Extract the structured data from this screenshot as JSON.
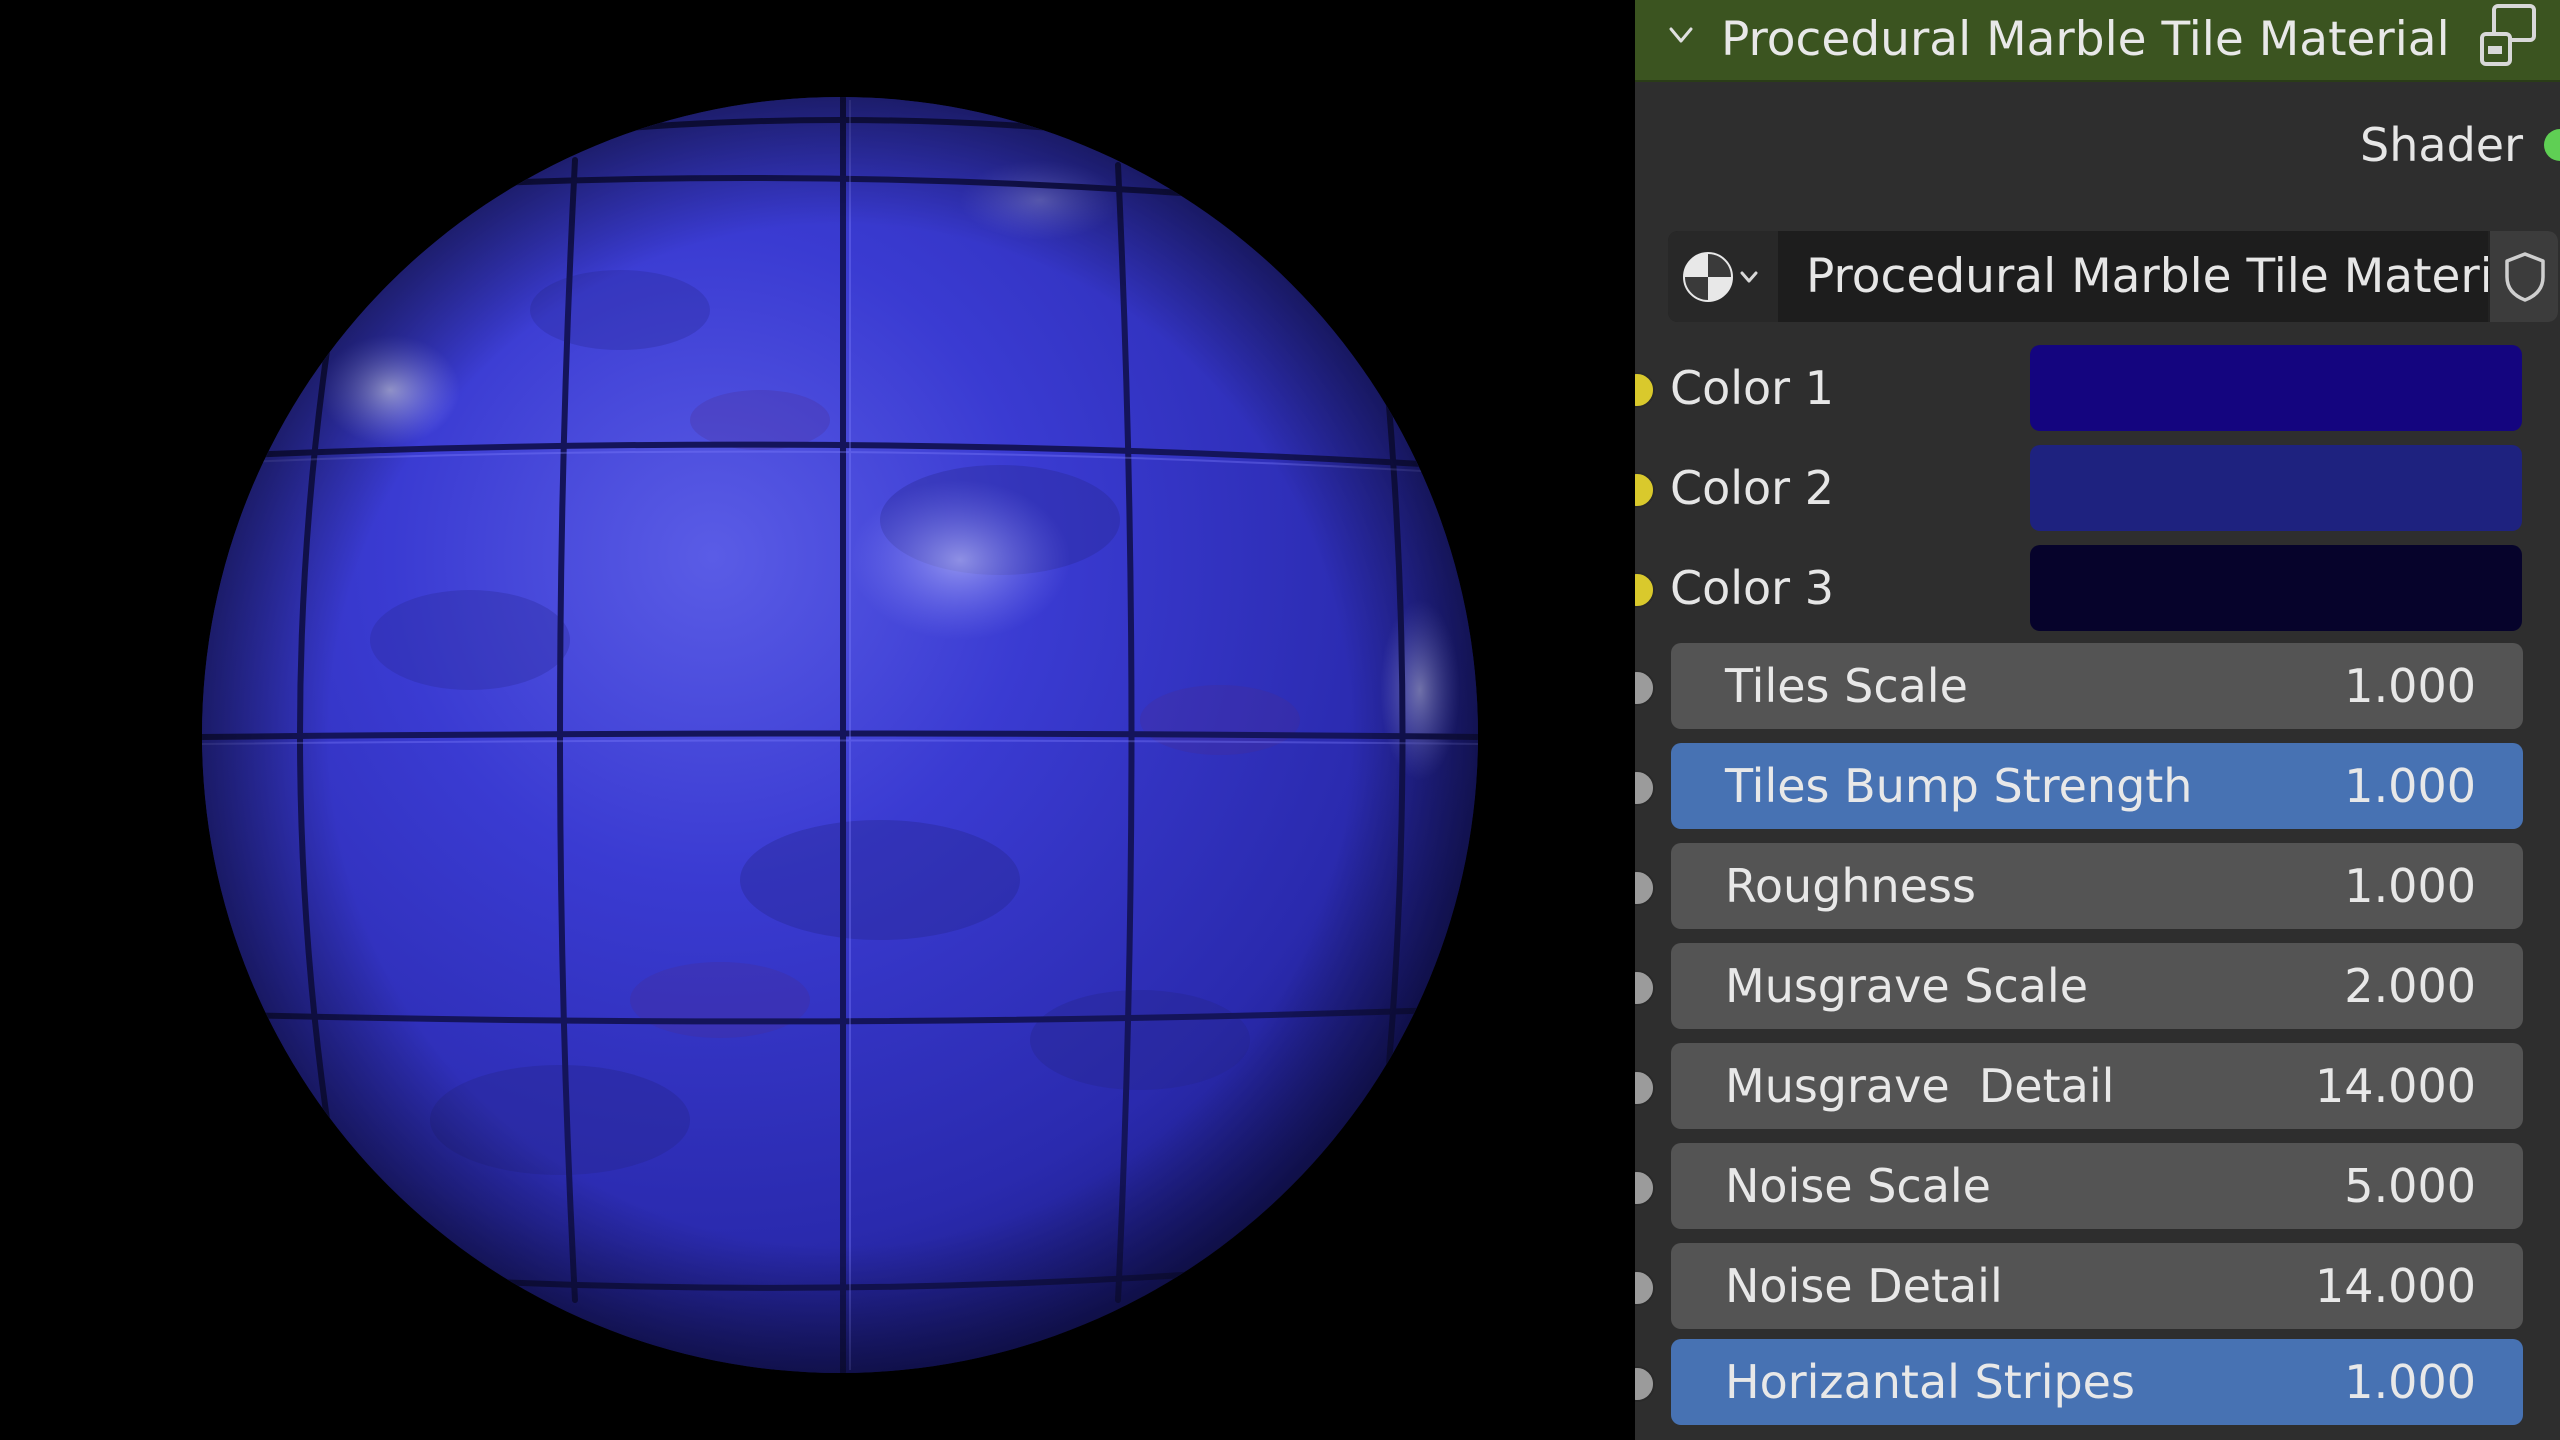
{
  "node": {
    "title": "Procedural Marble Tile Material",
    "output_label": "Shader",
    "material_name": "Procedural Marble Tile Material",
    "icons": {
      "collapse": "chevron-down-icon",
      "header": "node-group-icon",
      "material_type": "material-sphere-icon",
      "fake_user": "shield-icon"
    }
  },
  "colors": [
    {
      "label": "Color 1",
      "value": "#14057f"
    },
    {
      "label": "Color 2",
      "value": "#1e227f"
    },
    {
      "label": "Color 3",
      "value": "#06032b"
    }
  ],
  "inputs": [
    {
      "label": "Tiles Scale",
      "value": "1.000",
      "active": false
    },
    {
      "label": "Tiles Bump Strength",
      "value": "1.000",
      "active": true
    },
    {
      "label": "Roughness",
      "value": "1.000",
      "active": false
    },
    {
      "label": "Musgrave Scale",
      "value": "2.000",
      "active": false
    },
    {
      "label": "Musgrave  Detail",
      "value": "14.000",
      "active": false
    },
    {
      "label": "Noise Scale",
      "value": "5.000",
      "active": false
    },
    {
      "label": "Noise Detail",
      "value": "14.000",
      "active": false
    },
    {
      "label": "Horizantal Stripes",
      "value": "1.000",
      "active": true
    }
  ],
  "theme": {
    "header_color": "#3b5420",
    "panel_color": "#2e2e2e",
    "active_field": "#4772b3",
    "field_color": "#545454",
    "sphere_color": "#2f2fc4"
  }
}
